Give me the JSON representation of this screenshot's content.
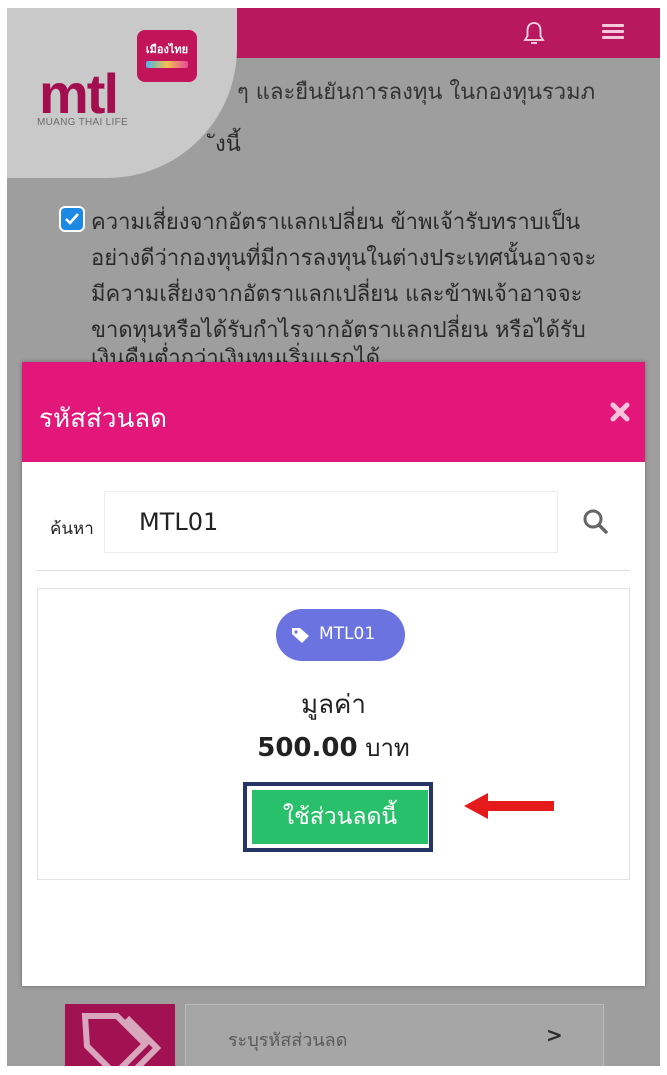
{
  "header": {
    "bell_icon": "bell-icon",
    "menu_icon": "hamburger-menu-icon",
    "bar_color": "#b8185d"
  },
  "logo": {
    "text": "mtl",
    "subtitle": "MUANG THAI LIFE",
    "badge_text": "เมืองไทย"
  },
  "background": {
    "partial_line_1": "ๆ และยืนยันการลงทุน ในกองทุนรวมภ",
    "partial_line_2": "ังนี้",
    "disclaimer_lines": [
      "ความเสี่ยงจากอัตราแลกเปลี่ยน ข้าพเจ้ารับทราบเป็น",
      "อย่างดีว่ากองทุนที่มีการลงทุนในต่างประเทศนั้นอาจจะ",
      "มีความเสี่ยงจากอัตราแลกเปลี่ยน และข้าพเจ้าอาจจะ",
      "ขาดทุนหรือได้รับกำไรจากอัตราแลกปลี่ยน หรือได้รับ",
      "เงินคืนต่ำกว่าเงินทุนเริ่มแรกได้"
    ],
    "disclaimer_checked": true
  },
  "modal": {
    "title": "รหัสส่วนลด",
    "header_color": "#e3177a",
    "close_icon": "close-x-icon",
    "search": {
      "label": "ค้นหา",
      "value": "MTL01",
      "icon": "search-icon"
    },
    "coupon": {
      "code": "MTL01",
      "tag_icon": "tag-icon",
      "value_label": "มูลค่า",
      "amount": "500.00",
      "currency": "บาท",
      "apply_label": "ใช้ส่วนลดนี้",
      "pill_color": "#6a73e0",
      "apply_color": "#29c06b"
    }
  },
  "annotation": {
    "arrow_color": "#e51a1a"
  },
  "promo_row": {
    "placeholder": "ระบุรหัสส่วนลด",
    "chevron": ">",
    "icon": "tag-icon"
  }
}
